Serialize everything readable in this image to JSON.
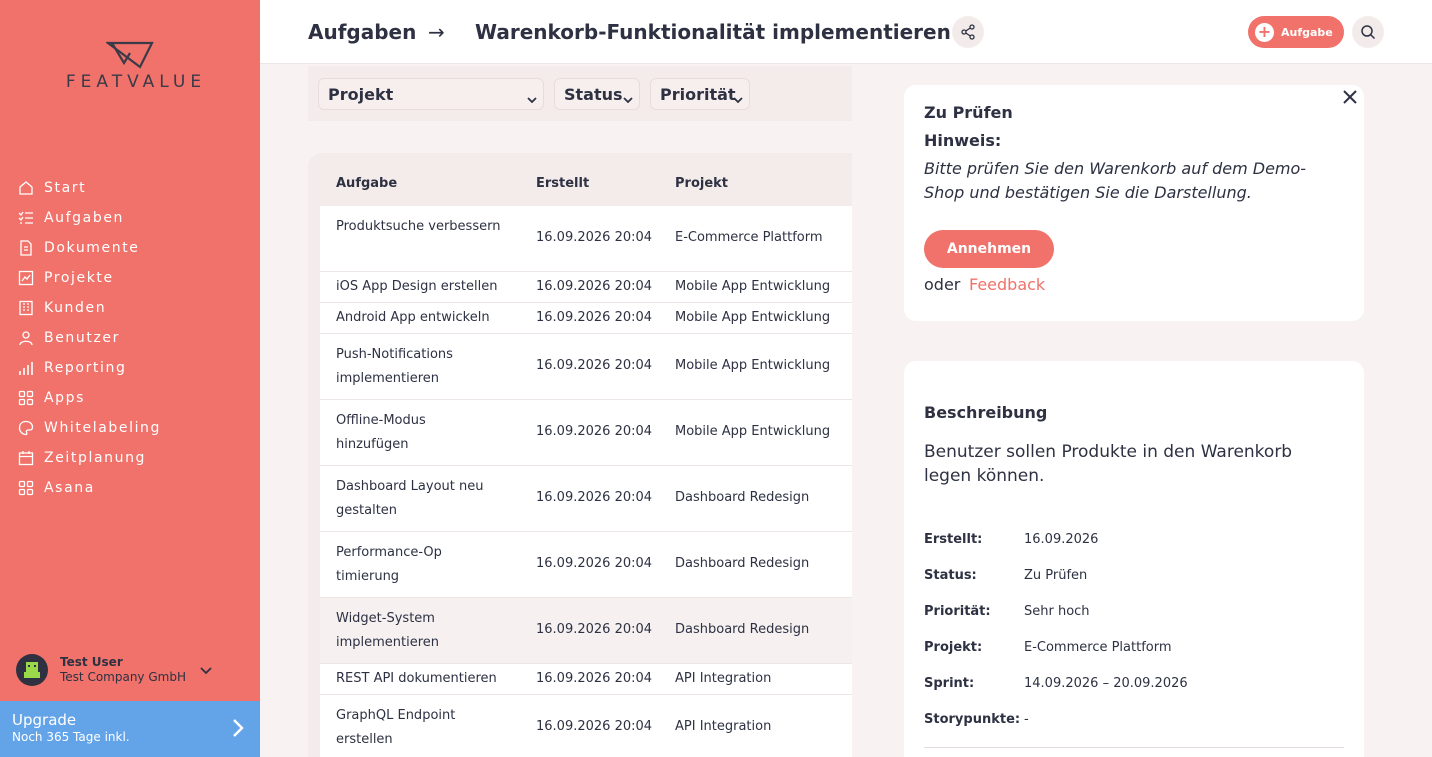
{
  "brand": {
    "name": "FEATVALUE",
    "accent": "#f0726a"
  },
  "sidebar": {
    "items": [
      {
        "label": "Start",
        "icon": "home-icon"
      },
      {
        "label": "Aufgaben",
        "icon": "tasks-icon"
      },
      {
        "label": "Dokumente",
        "icon": "documents-icon"
      },
      {
        "label": "Projekte",
        "icon": "projects-icon"
      },
      {
        "label": "Kunden",
        "icon": "building-icon"
      },
      {
        "label": "Benutzer",
        "icon": "user-icon"
      },
      {
        "label": "Reporting",
        "icon": "chart-icon"
      },
      {
        "label": "Apps",
        "icon": "apps-icon"
      },
      {
        "label": "Whitelabeling",
        "icon": "palette-icon"
      },
      {
        "label": "Zeitplanung",
        "icon": "calendar-icon"
      },
      {
        "label": "Asana",
        "icon": "apps-icon"
      }
    ],
    "user": {
      "name": "Test User",
      "company": "Test Company GmbH"
    },
    "upgrade": {
      "title": "Upgrade",
      "subtitle": "Noch 365 Tage inkl."
    }
  },
  "header": {
    "breadcrumb_root": "Aufgaben",
    "breadcrumb_arrow": "→",
    "title": "Warenkorb-Funktionalität implementieren",
    "add_label": "Aufgabe"
  },
  "filters": {
    "projekt": "Projekt",
    "status": "Status",
    "prioritaet": "Priorität"
  },
  "table": {
    "headers": {
      "aufgabe": "Aufgabe",
      "erstellt": "Erstellt",
      "projekt": "Projekt"
    },
    "rows": [
      {
        "aufgabe": "Produktsuche verbessern",
        "erstellt": "16.09.2026 20:04",
        "projekt": "E-Commerce Plattform"
      },
      {
        "aufgabe": "iOS App Design erstellen",
        "erstellt": "16.09.2026 20:04",
        "projekt": "Mobile App Entwicklung"
      },
      {
        "aufgabe": "Android App entwickeln",
        "erstellt": "16.09.2026 20:04",
        "projekt": "Mobile App Entwicklung"
      },
      {
        "aufgabe": "Push-Notifications implementieren",
        "erstellt": "16.09.2026 20:04",
        "projekt": "Mobile App Entwicklung"
      },
      {
        "aufgabe": "Offline-Modus hinzufügen",
        "erstellt": "16.09.2026 20:04",
        "projekt": "Mobile App Entwicklung"
      },
      {
        "aufgabe": "Dashboard Layout neu gestalten",
        "erstellt": "16.09.2026 20:04",
        "projekt": "Dashboard Redesign"
      },
      {
        "aufgabe": "Performance-Optimierung",
        "erstellt": "16.09.2026 20:04",
        "projekt": "Dashboard Redesign"
      },
      {
        "aufgabe": "Widget-System implementieren",
        "erstellt": "16.09.2026 20:04",
        "projekt": "Dashboard Redesign"
      },
      {
        "aufgabe": "REST API dokumentieren",
        "erstellt": "16.09.2026 20:04",
        "projekt": "API Integration"
      },
      {
        "aufgabe": "GraphQL Endpoint erstellen",
        "erstellt": "16.09.2026 20:04",
        "projekt": "API Integration"
      }
    ]
  },
  "review": {
    "title": "Zu Prüfen",
    "hint_label": "Hinweis:",
    "hint_text": "Bitte prüfen Sie den Warenkorb auf dem Demo-Shop und bestätigen Sie die Darstellung.",
    "accept_label": "Annehmen",
    "or_label": "oder",
    "feedback_label": "Feedback"
  },
  "details": {
    "title": "Beschreibung",
    "description": "Benutzer sollen Produkte in den Warenkorb legen können.",
    "fields": [
      {
        "key": "Erstellt:",
        "value": "16.09.2026"
      },
      {
        "key": "Status:",
        "value": "Zu Prüfen"
      },
      {
        "key": "Priorität:",
        "value": "Sehr hoch"
      },
      {
        "key": "Projekt:",
        "value": "E-Commerce Plattform"
      },
      {
        "key": "Sprint:",
        "value": "14.09.2026 – 20.09.2026"
      },
      {
        "key": "Storypunkte:",
        "value": "-"
      }
    ]
  }
}
